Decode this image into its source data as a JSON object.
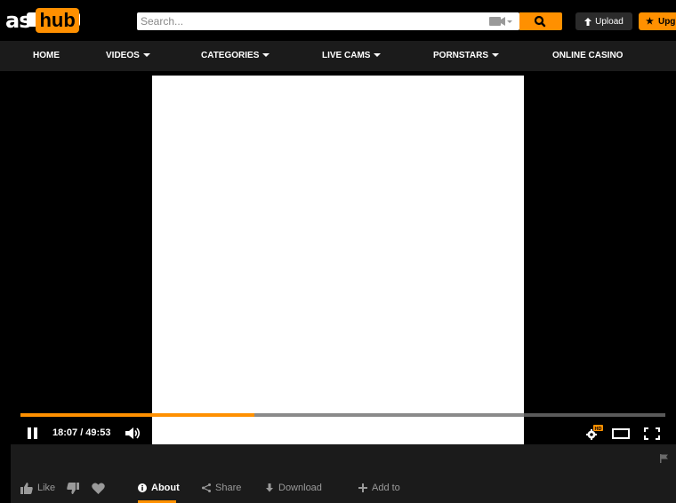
{
  "header": {
    "logo_left": "as",
    "logo_hub": "hub",
    "search_placeholder": "Search...",
    "upload_label": "Upload",
    "upgrade_label": "Upg"
  },
  "nav": {
    "items": [
      {
        "label": "HOME",
        "has_caret": false
      },
      {
        "label": "VIDEOS",
        "has_caret": true
      },
      {
        "label": "CATEGORIES",
        "has_caret": true
      },
      {
        "label": "LIVE CAMS",
        "has_caret": true
      },
      {
        "label": "PORNSTARS",
        "has_caret": true
      },
      {
        "label": "ONLINE CASINO",
        "has_caret": false
      }
    ]
  },
  "player": {
    "current_time": "18:07",
    "duration": "49:53",
    "time_display": "18:07 / 49:53",
    "played_fraction": 0.363,
    "buffered_fraction": 0.78,
    "settings_badge": "HD"
  },
  "actions": {
    "like_label": "Like",
    "about_label": "About",
    "share_label": "Share",
    "download_label": "Download",
    "add_to_label": "Add to"
  },
  "colors": {
    "accent": "#ff9000",
    "background": "#000000",
    "bar": "#1b1b1b",
    "muted_text": "#9a9a9a"
  }
}
